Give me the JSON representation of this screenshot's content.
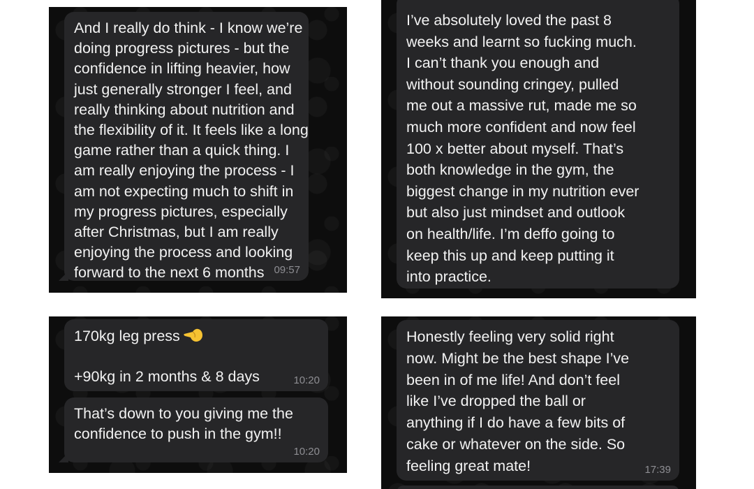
{
  "screenshots": [
    {
      "messages": [
        {
          "lines": [
            "And I really do think - I know we’re",
            "doing progress pictures - but the",
            "confidence in lifting heavier, how",
            "just generally stronger I feel, and",
            "really thinking about nutrition and",
            "the flexibility of it. It feels like a long",
            "game rather than a quick thing. I",
            "am really enjoying the process - I",
            "am not expecting much to shift in",
            "my progress pictures, especially",
            "after Christmas, but I am really",
            "enjoying the process and looking",
            "forward to the next 6 months"
          ],
          "time": "09:57"
        }
      ]
    },
    {
      "messages": [
        {
          "lines": [
            "I’ve absolutely loved the past 8",
            "weeks and learnt so fucking much.",
            "I can’t thank you enough and",
            "without sounding cringey, pulled",
            "me out a massive rut, made me so",
            "much more confident and now feel",
            "100 x better about myself. That’s",
            "both knowledge in the gym, the",
            "biggest change in my nutrition ever",
            "but also just mindset and outlook",
            "on health/life. I’m deffo going to",
            "keep this up and keep putting it",
            "into practice."
          ],
          "time": ""
        }
      ]
    },
    {
      "messages": [
        {
          "lines": [
            "170kg leg press",
            "",
            "+90kg in 2 months & 8 days"
          ],
          "emoji": "pointing-left-hand-emoji",
          "time": "10:20"
        },
        {
          "lines": [
            "That’s down to you giving me the",
            "confidence to push in the gym!!"
          ],
          "time": "10:20"
        }
      ]
    },
    {
      "messages": [
        {
          "lines": [
            "Honestly feeling very solid right",
            "now. Might be the best shape I’ve",
            "been in of me life! And don’t feel",
            "like I’ve dropped the ball or",
            "anything if I do have a few bits of",
            "cake or whatever on the side. So",
            "feeling great mate!"
          ],
          "time": "17:39"
        }
      ]
    }
  ],
  "colors": {
    "panel_background": "#0d0d0d",
    "bubble_background": "#262628",
    "message_text": "#f2f2f2",
    "timestamp_text": "#8e8e93",
    "page_background": "#ffffff",
    "emoji_fill": "#f6c232"
  }
}
